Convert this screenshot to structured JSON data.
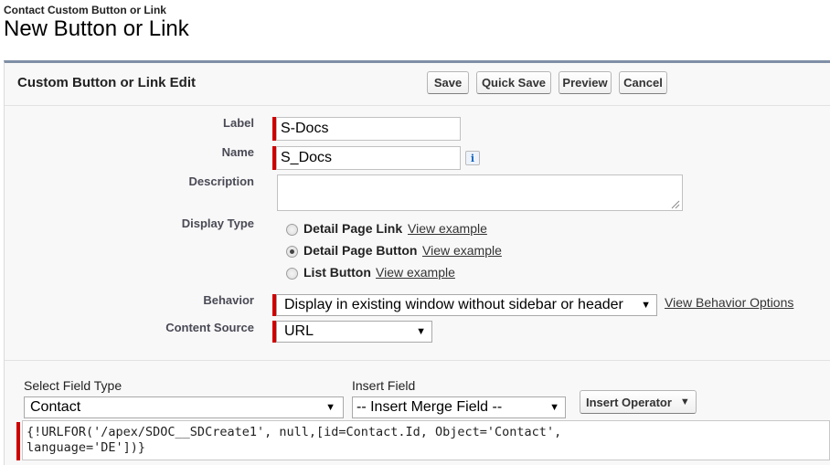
{
  "header": {
    "breadcrumb": "Contact Custom Button or Link",
    "title": "New Button or Link"
  },
  "panel": {
    "title": "Custom Button or Link Edit",
    "buttons": {
      "save": "Save",
      "quick_save": "Quick Save",
      "preview": "Preview",
      "cancel": "Cancel"
    }
  },
  "form": {
    "label": {
      "label": "Label",
      "value": "S-Docs"
    },
    "name": {
      "label": "Name",
      "value": "S_Docs",
      "info_icon": "i"
    },
    "description": {
      "label": "Description",
      "value": ""
    },
    "display_type": {
      "label": "Display Type",
      "options": [
        {
          "label": "Detail Page Link",
          "link": "View example",
          "selected": false
        },
        {
          "label": "Detail Page Button",
          "link": "View example",
          "selected": true
        },
        {
          "label": "List Button",
          "link": "View example",
          "selected": false
        }
      ]
    },
    "behavior": {
      "label": "Behavior",
      "value": "Display in existing window without sidebar or header",
      "link": "View Behavior Options"
    },
    "content_source": {
      "label": "Content Source",
      "value": "URL"
    }
  },
  "formula": {
    "select_field_type": {
      "label": "Select Field Type",
      "value": "Contact"
    },
    "insert_field": {
      "label": "Insert Field",
      "value": "-- Insert Merge Field --"
    },
    "insert_operator": "Insert Operator",
    "code_line1": "{!URLFOR('/apex/SDOC__SDCreate1', null,[id=Contact.Id, Object='Contact',",
    "code_line2": "language='DE'])}"
  },
  "icons": [
    "info-icon",
    "dropdown-arrow-icon",
    "resize-handle-icon"
  ],
  "colors": {
    "required": "#cc0000",
    "panel_border": "#7f8fa6",
    "panel_bg": "#f8f8f8"
  }
}
